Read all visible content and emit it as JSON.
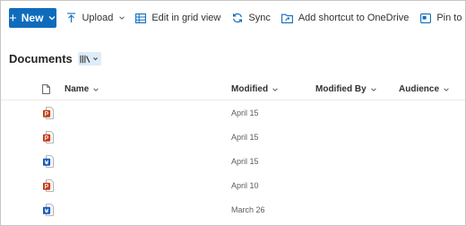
{
  "toolbar": {
    "new_label": "New",
    "upload_label": "Upload",
    "grid_label": "Edit in grid view",
    "sync_label": "Sync",
    "shortcut_label": "Add shortcut to OneDrive",
    "pin_label": "Pin to Quick access"
  },
  "library": {
    "title": "Documents"
  },
  "columns": {
    "name": "Name",
    "modified": "Modified",
    "modified_by": "Modified By",
    "audience": "Audience"
  },
  "files": [
    {
      "type": "powerpoint",
      "modified": "April 15"
    },
    {
      "type": "powerpoint",
      "modified": "April 15"
    },
    {
      "type": "word",
      "modified": "April 15"
    },
    {
      "type": "powerpoint",
      "modified": "April 10"
    },
    {
      "type": "word",
      "modified": "March 26"
    }
  ],
  "colors": {
    "accent": "#0f6cbd",
    "powerpoint": "#c43e1c",
    "word": "#185abd"
  }
}
